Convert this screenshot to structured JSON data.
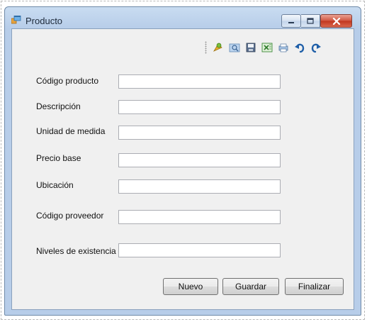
{
  "window": {
    "title": "Producto"
  },
  "toolbar": {
    "icons": [
      "new-icon",
      "search-icon",
      "save-icon",
      "excel-icon",
      "print-icon",
      "undo-icon",
      "redo-icon"
    ]
  },
  "form": {
    "fields": [
      {
        "label": "Código producto",
        "value": ""
      },
      {
        "label": "Descripción",
        "value": ""
      },
      {
        "label": "Unidad de medida",
        "value": ""
      },
      {
        "label": "Precio base",
        "value": ""
      },
      {
        "label": "Ubicación",
        "value": ""
      },
      {
        "label": "Código proveedor",
        "value": ""
      },
      {
        "label": "Niveles de existencia",
        "value": ""
      }
    ]
  },
  "buttons": {
    "new_label": "Nuevo",
    "save_label": "Guardar",
    "finish_label": "Finalizar"
  },
  "colors": {
    "titlebar": "#b7cde9",
    "client": "#f0f0f0",
    "close_button": "#c1351e"
  }
}
